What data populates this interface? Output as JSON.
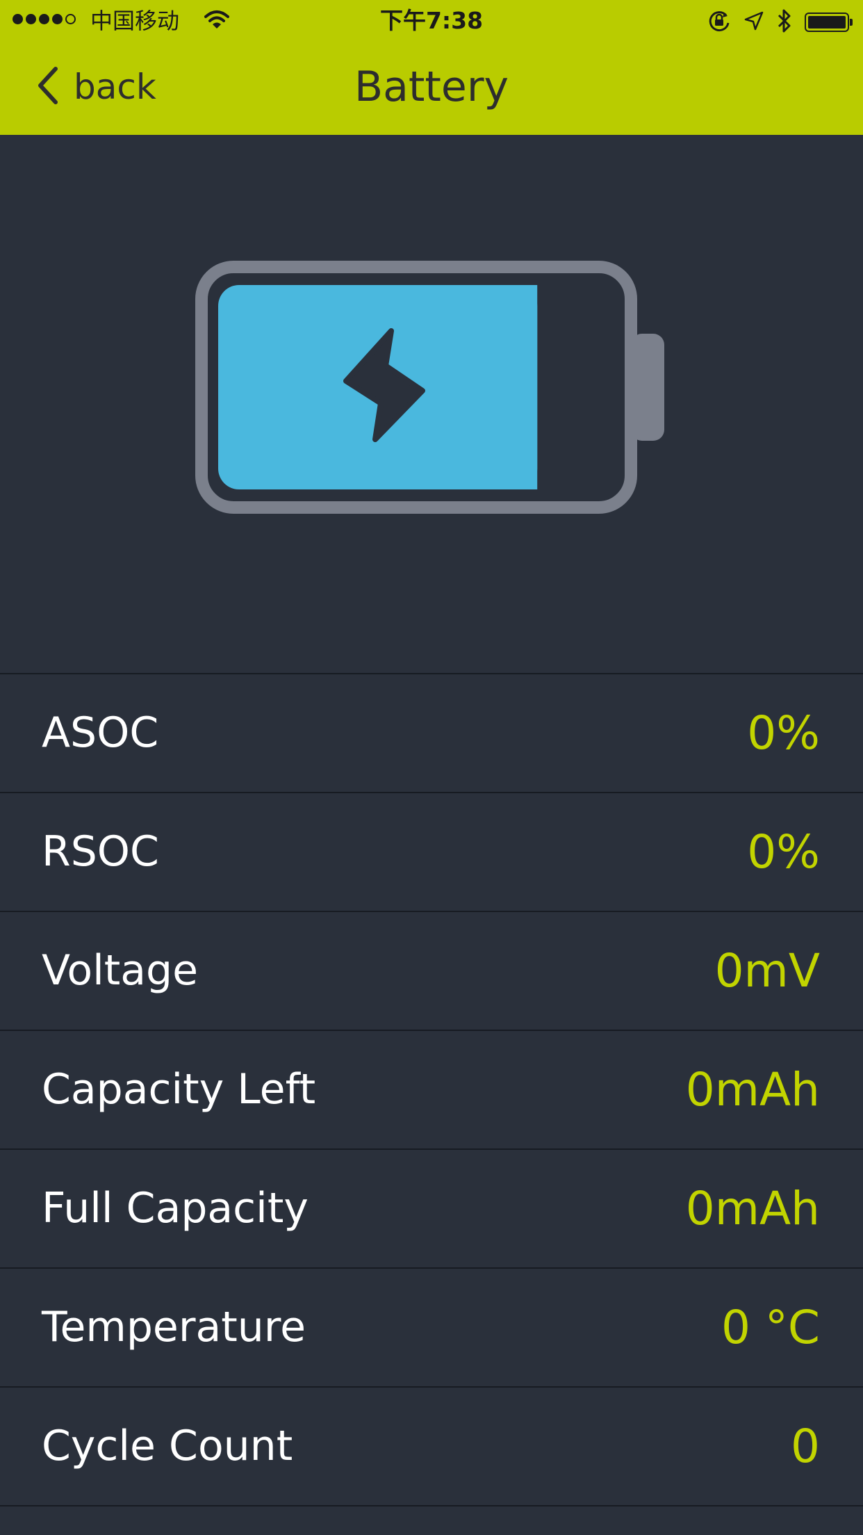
{
  "status_bar": {
    "carrier": "中国移动",
    "time": "下午7:38",
    "signal_bars_filled": 4,
    "signal_bars_total": 5,
    "icons": [
      "wifi-icon",
      "orientation-lock-icon",
      "location-arrow-icon",
      "bluetooth-icon",
      "battery-icon"
    ]
  },
  "nav": {
    "back_label": "back",
    "title": "Battery"
  },
  "battery_graphic": {
    "fill_level": 0.8,
    "fill_color": "#4ab8de",
    "outline_color": "#7b808c",
    "icon": "lightning-bolt-icon"
  },
  "rows": [
    {
      "label": "ASOC",
      "value": "0%"
    },
    {
      "label": "RSOC",
      "value": "0%"
    },
    {
      "label": "Voltage",
      "value": "0mV"
    },
    {
      "label": "Capacity Left",
      "value": "0mAh"
    },
    {
      "label": "Full Capacity",
      "value": "0mAh"
    },
    {
      "label": "Temperature",
      "value": "0 °C"
    },
    {
      "label": "Cycle Count",
      "value": "0"
    }
  ],
  "colors": {
    "accent": "#b9cc00",
    "value_text": "#c2d400",
    "background": "#2a303b",
    "divider": "#171b22"
  }
}
